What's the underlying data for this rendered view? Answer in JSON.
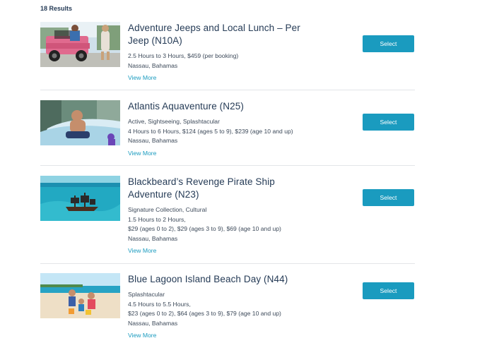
{
  "results_count": "18 Results",
  "accent_color": "#1a9bbf",
  "items": [
    {
      "title": "Adventure Jeeps and Local Lunch – Per Jeep (N10A)",
      "lines": [
        "2.5 Hours to 3 Hours, $459 (per booking)",
        "Nassau, Bahamas"
      ],
      "view_more": "View More",
      "select_label": "Select",
      "image": "pink-jeep-photo"
    },
    {
      "title": "Atlantis Aquaventure (N25)",
      "lines": [
        "Active, Sightseeing, Splashtacular",
        "4 Hours to 6 Hours, $124 (ages 5 to 9), $239 (age 10 and up)",
        "Nassau, Bahamas"
      ],
      "view_more": "View More",
      "select_label": "Select",
      "image": "water-slide-photo"
    },
    {
      "title": "Blackbeard’s Revenge Pirate Ship Adventure (N23)",
      "lines": [
        "Signature Collection, Cultural",
        "1.5 Hours to 2 Hours,",
        "$29 (ages 0 to 2), $29 (ages 3 to 9), $69 (age 10 and up)",
        "Nassau, Bahamas"
      ],
      "view_more": "View More",
      "select_label": "Select",
      "image": "pirate-ship-photo"
    },
    {
      "title": "Blue Lagoon Island Beach Day (N44)",
      "lines": [
        "Splashtacular",
        "4.5 Hours to 5.5 Hours,",
        "$23 (ages 0 to 2), $64 (ages 3 to 9), $79 (age 10 and up)",
        "Nassau, Bahamas"
      ],
      "view_more": "View More",
      "select_label": "Select",
      "image": "beach-family-photo"
    }
  ]
}
